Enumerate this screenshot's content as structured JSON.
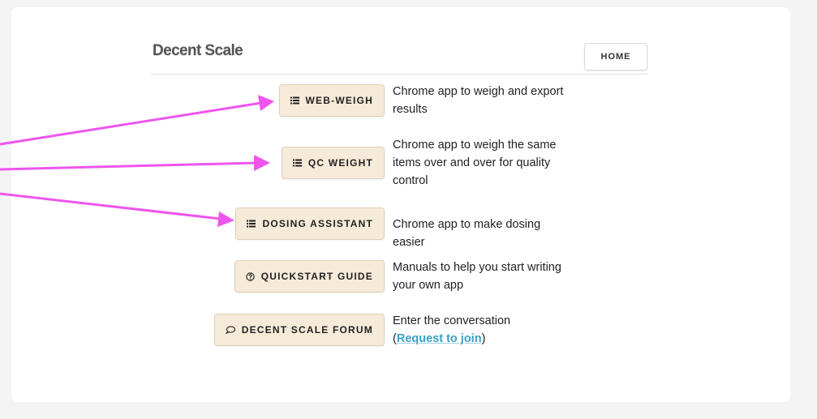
{
  "header": {
    "title": "Decent Scale",
    "home_label": "HOME"
  },
  "items": [
    {
      "icon": "list-icon",
      "label": "WEB-WEIGH",
      "description": "Chrome app to weigh and export results"
    },
    {
      "icon": "list-icon",
      "label": "QC WEIGHT",
      "description": "Chrome app to weigh the same items over and over for quality control"
    },
    {
      "icon": "list-icon",
      "label": "DOSING ASSISTANT",
      "description": "Chrome app to make dosing easier"
    },
    {
      "icon": "help-circle-icon",
      "label": "QUICKSTART GUIDE",
      "description": "Manuals to help you start writing your own app"
    },
    {
      "icon": "chat-bubble-icon",
      "label": "DECENT SCALE FORUM",
      "description_prefix": "Enter the conversation",
      "link_open": "(",
      "link_text": "Request to join",
      "link_close": ")"
    }
  ],
  "colors": {
    "button_bg": "#f6ebd8",
    "link": "#3aa3c7",
    "annotation_arrow": "#ee55ee"
  }
}
